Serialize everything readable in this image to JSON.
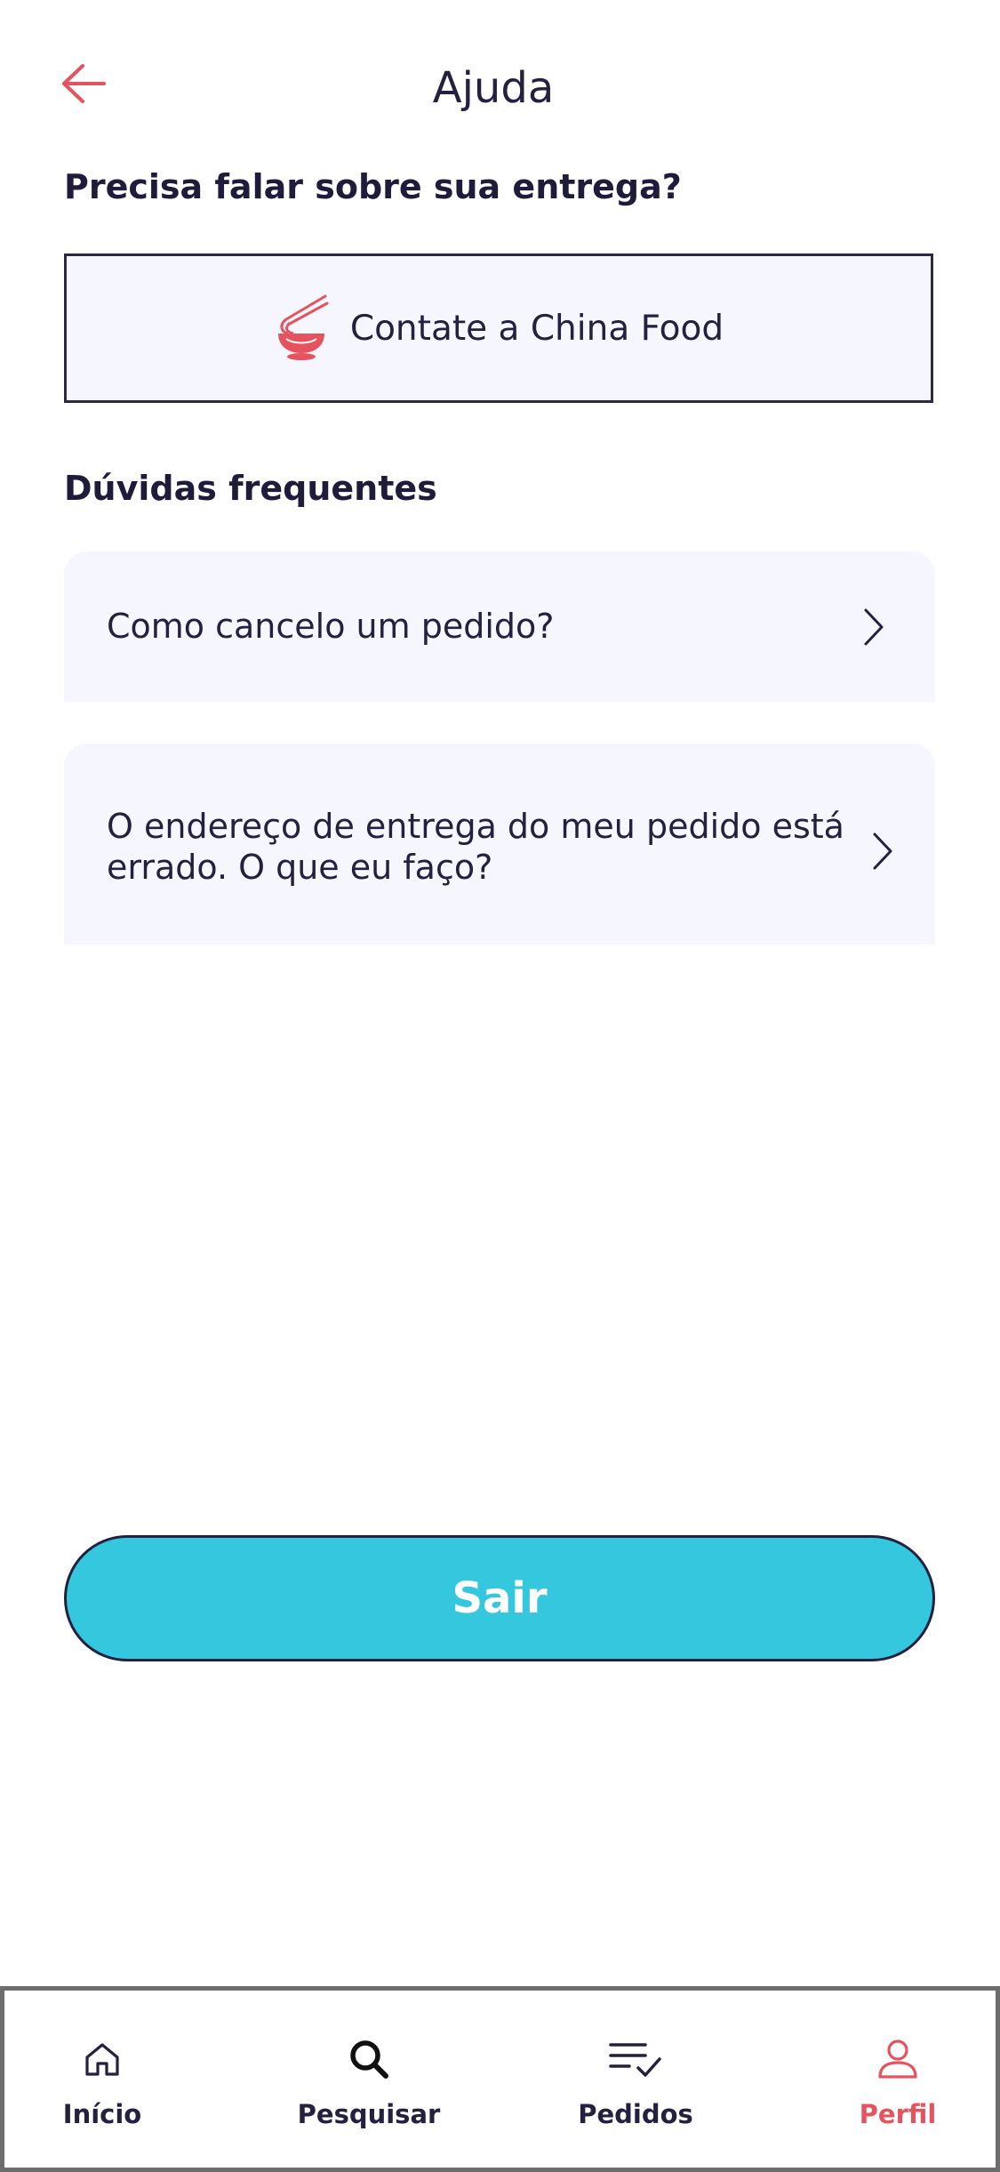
{
  "header": {
    "title": "Ajuda",
    "back_icon": "arrow-left-icon"
  },
  "delivery_section": {
    "title": "Precisa falar sobre sua entrega?",
    "contact_button_label": "Contate a China Food",
    "contact_icon": "noodle-bowl-icon"
  },
  "faq_section": {
    "title": "Dúvidas frequentes",
    "items": [
      {
        "question": "Como cancelo um pedido?"
      },
      {
        "question": "O endereço de entrega do meu pedido está errado. O que eu faço?"
      }
    ]
  },
  "logout": {
    "label": "Sair"
  },
  "bottom_nav": {
    "items": [
      {
        "label": "Início",
        "icon": "home-icon",
        "active": false
      },
      {
        "label": "Pesquisar",
        "icon": "search-icon",
        "active": false
      },
      {
        "label": "Pedidos",
        "icon": "orders-list-icon",
        "active": false
      },
      {
        "label": "Perfil",
        "icon": "user-icon",
        "active": true
      }
    ]
  },
  "colors": {
    "accent": "#e5545e",
    "primary_text": "#23213f",
    "card_background": "#f5f6fe",
    "logout_button": "#34c7de"
  }
}
